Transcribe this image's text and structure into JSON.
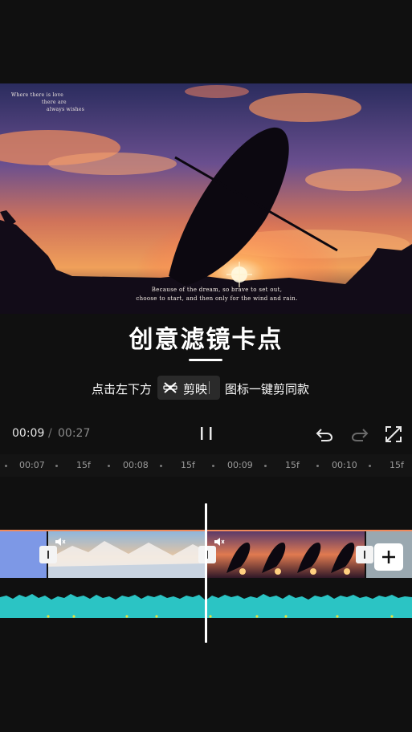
{
  "preview": {
    "corner_lines": [
      "Where there is love",
      "there are",
      "always wishes"
    ],
    "caption_lines": [
      "Because of the dream, so brave to set out,",
      "choose to start, and then only for the wind and rain."
    ]
  },
  "title": "创意滤镜卡点",
  "hint": {
    "left": "点击左下方",
    "app_name": "剪映",
    "right": "图标一键剪同款"
  },
  "player": {
    "current_time": "00:09",
    "separator": "/",
    "total_time": "00:27"
  },
  "ruler": {
    "labels": [
      "00:07",
      "15f",
      "00:08",
      "15f",
      "00:09",
      "15f",
      "00:10",
      "15f"
    ]
  },
  "icons": [
    "pause-icon",
    "undo-icon",
    "redo-icon",
    "fullscreen-icon",
    "mute-icon",
    "add-icon",
    "capcut-logo-icon"
  ],
  "colors": {
    "background": "#101010",
    "track_border": "#f08a5d",
    "waveform": "#2bc4c4",
    "playhead": "#ffffff"
  }
}
